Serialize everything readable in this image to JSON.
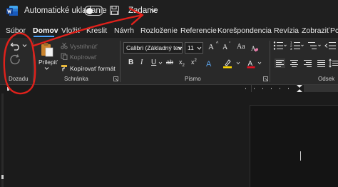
{
  "titlebar": {
    "autosave_label": "Automatické ukladanie",
    "doc_title": "Zadanie"
  },
  "tabs": [
    {
      "label": "Súbor",
      "active": false
    },
    {
      "label": "Domov",
      "active": true
    },
    {
      "label": "Vložiť",
      "active": false
    },
    {
      "label": "Kreslit",
      "active": false
    },
    {
      "label": "Návrh",
      "active": false
    },
    {
      "label": "Rozloženie",
      "active": false
    },
    {
      "label": "Referencie",
      "active": false
    },
    {
      "label": "Korešpondencia",
      "active": false
    },
    {
      "label": "Revízia",
      "active": false
    },
    {
      "label": "Zobraziť",
      "active": false
    },
    {
      "label": "Pc",
      "active": false
    }
  ],
  "ribbon": {
    "undo_group_label": "Dozadu",
    "clipboard": {
      "paste_label": "Prilepiť",
      "cut_label": "Vystrihnúť",
      "copy_label": "Kopírovať",
      "format_painter_label": "Kopírovať formát",
      "group_label": "Schránka"
    },
    "font": {
      "font_name": "Calibri (Základný tex",
      "font_size": "11",
      "group_label": "Písmo",
      "font_color": "#e81123",
      "highlight_color": "#ffd800"
    },
    "paragraph": {
      "group_label": "Odsek"
    }
  },
  "annotation_color": "#e0211b"
}
